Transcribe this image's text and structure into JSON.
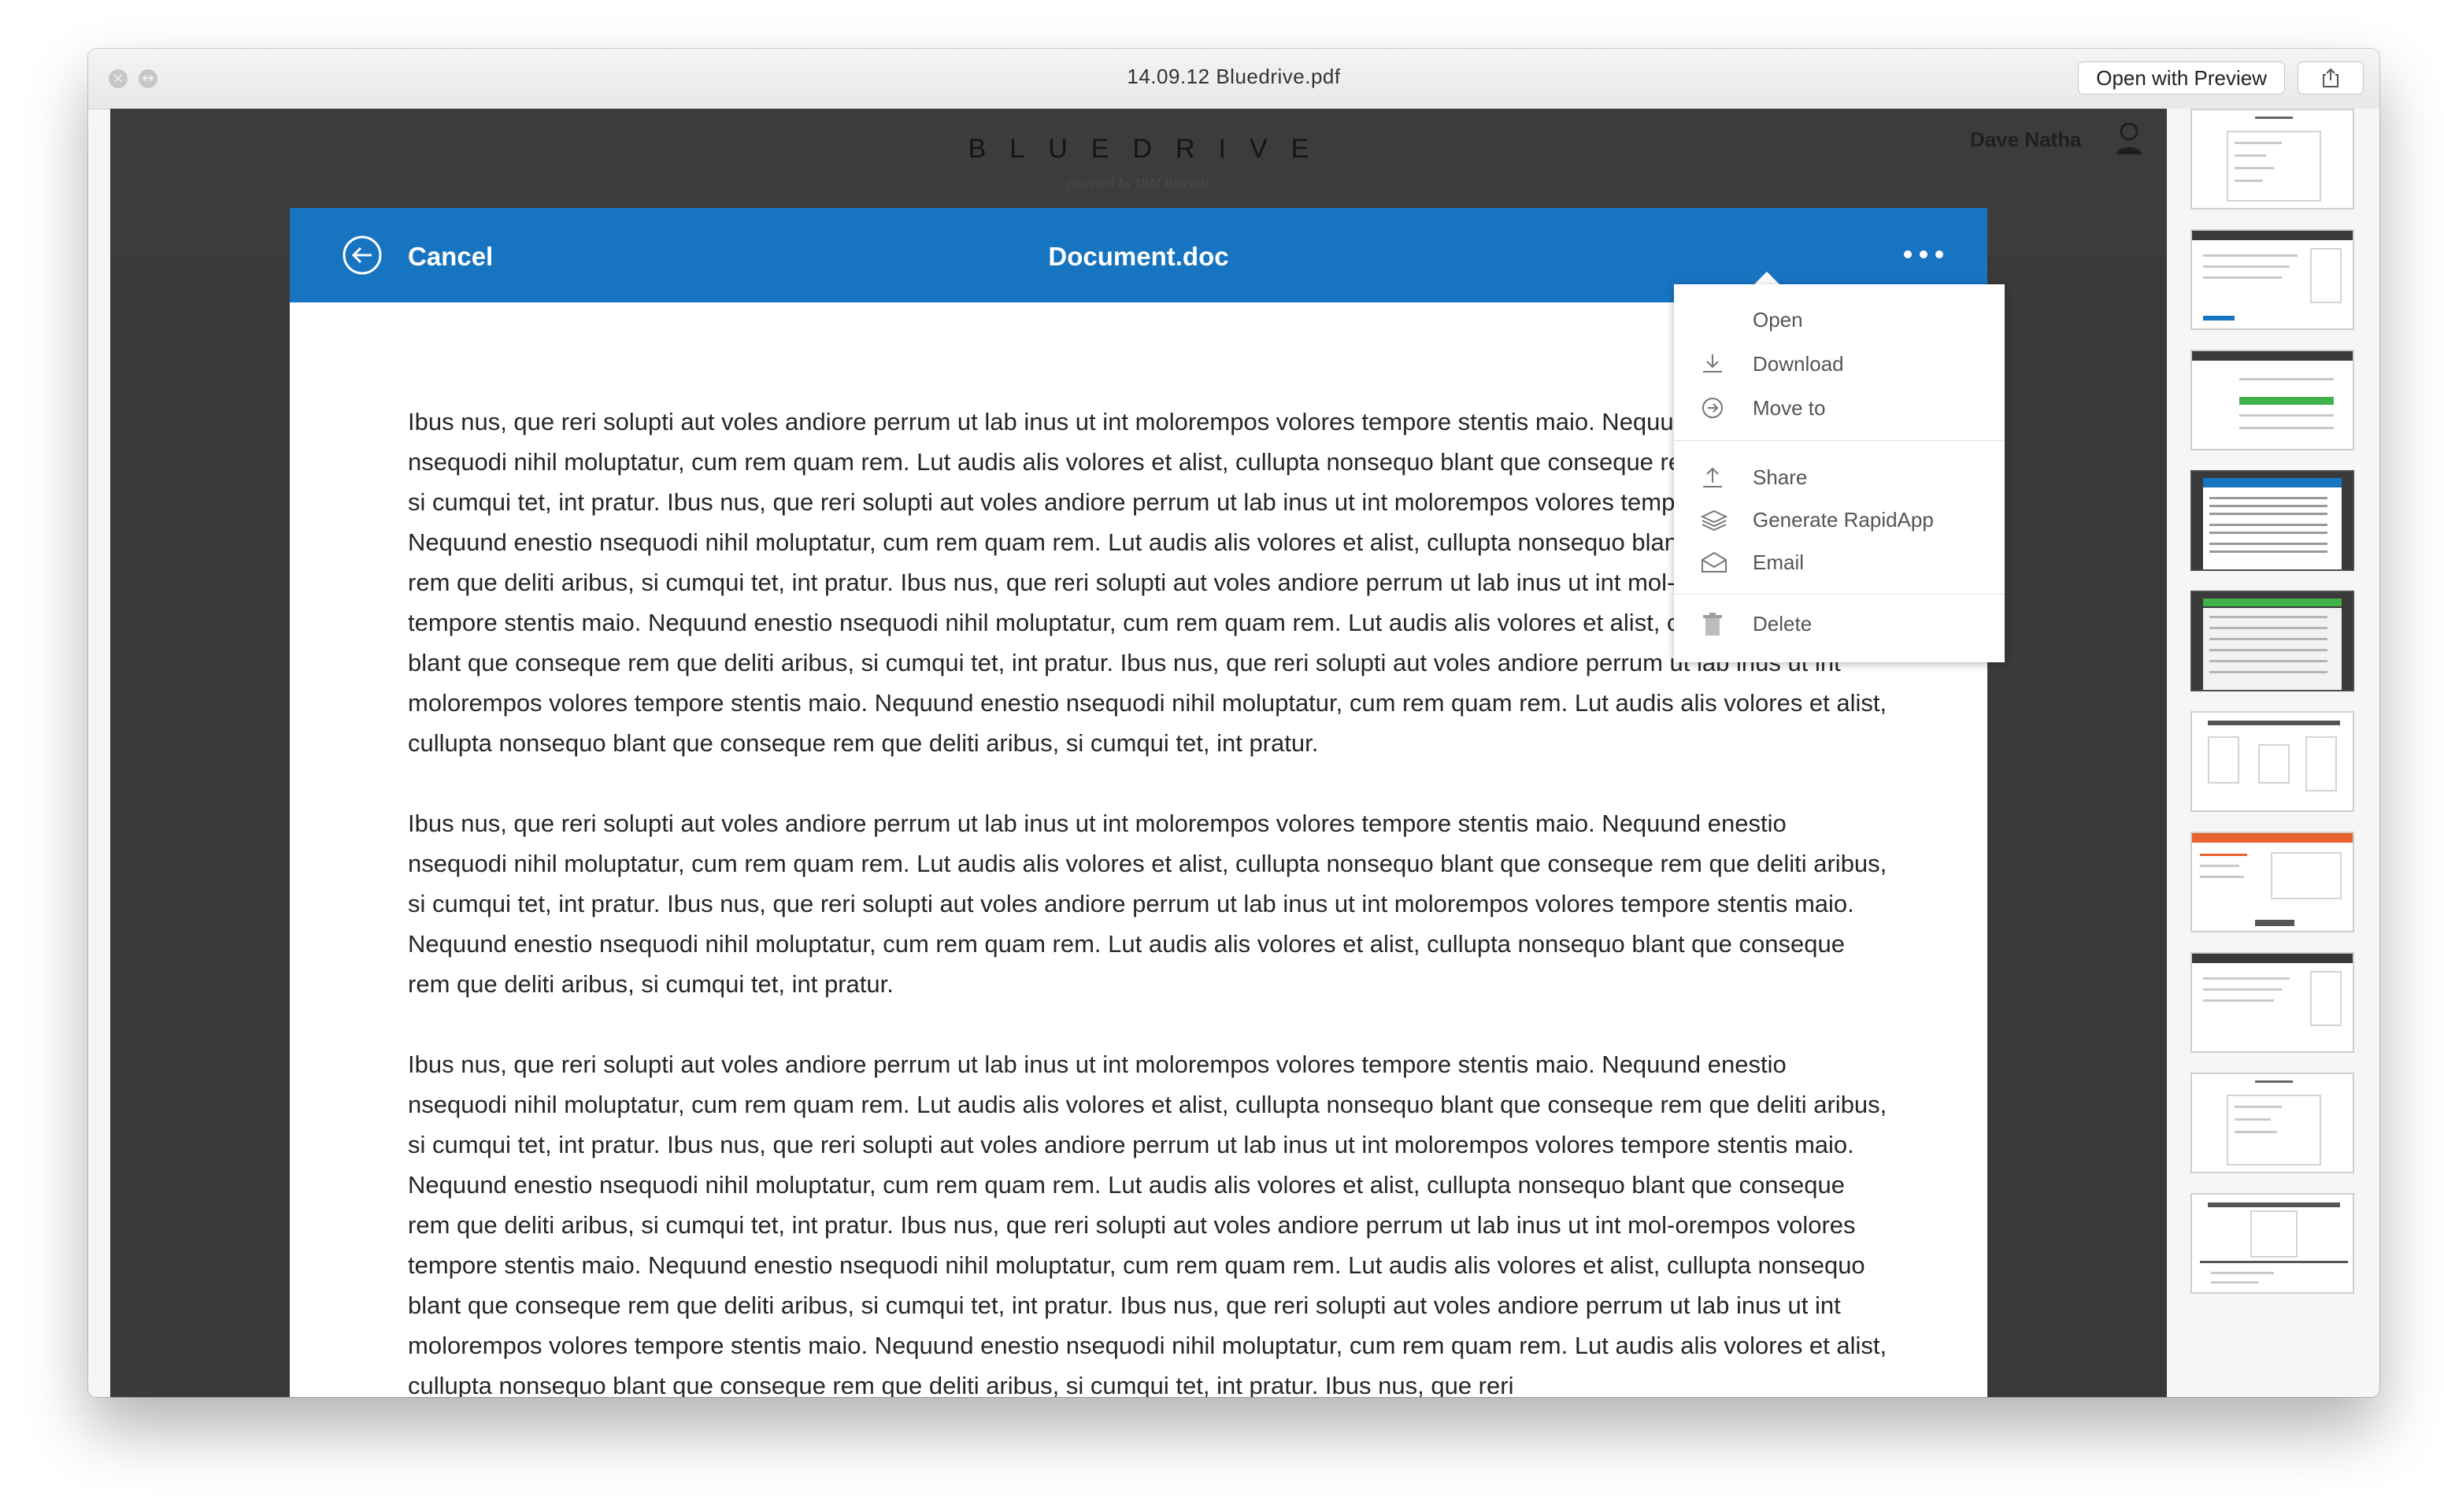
{
  "window": {
    "title": "14.09.12 Bluedrive.pdf",
    "open_with_label": "Open with Preview",
    "close_icon": "close-icon",
    "fullscreen_icon": "fullscreen-icon",
    "share_icon": "share-icon"
  },
  "app_header": {
    "logo_text": "BLUEDRIVE",
    "powered_by": "powered by IBM Bluemix",
    "user_name": "Dave Natha",
    "user_icon": "user-icon"
  },
  "modal": {
    "cancel_label": "Cancel",
    "title": "Document.doc",
    "accent_color": "#1774c1",
    "paragraphs": [
      "Ibus nus, que reri solupti aut voles andiore perrum ut lab inus ut int molorempos volores tempore stentis maio. Nequund enestio nsequodi nihil moluptatur, cum rem quam rem. Lut audis alis volores et alist, cullupta nonsequo blant que conseque rem que deliti aribus, si cumqui tet, int pratur. Ibus nus, que reri solupti aut voles andiore perrum ut lab inus ut int molorempos volores tempore stentis maio. Nequund enestio nsequodi nihil moluptatur, cum rem quam rem. Lut audis alis volores et alist, cullupta nonsequo blant que conseque rem que deliti aribus, si cumqui tet, int pratur. Ibus nus, que reri solupti aut voles andiore perrum ut lab inus ut int mol-orempos volores tempore stentis maio. Nequund enestio nsequodi nihil moluptatur, cum rem quam rem. Lut audis alis volores et alist, cullupta nonsequo blant que conseque rem que deliti aribus, si cumqui tet, int pratur. Ibus nus, que reri solupti aut voles andiore perrum ut lab inus ut int molorempos volores tempore stentis maio. Nequund enestio nsequodi nihil moluptatur, cum rem quam rem. Lut audis alis volores et alist, cullupta nonsequo blant que conseque rem que deliti aribus, si cumqui tet, int pratur.",
      "Ibus nus, que reri solupti aut voles andiore perrum ut lab inus ut int molorempos volores tempore stentis maio. Nequund enestio nsequodi nihil moluptatur, cum rem quam rem. Lut audis alis volores et alist, cullupta nonsequo blant que conseque rem que deliti aribus, si cumqui tet, int pratur. Ibus nus, que reri solupti aut voles andiore perrum ut lab inus ut int molorempos volores tempore stentis maio. Nequund enestio nsequodi nihil moluptatur, cum rem quam rem. Lut audis alis volores et alist, cullupta nonsequo blant que conseque rem que deliti aribus, si cumqui tet, int pratur.",
      "Ibus nus, que reri solupti aut voles andiore perrum ut lab inus ut int molorempos volores tempore stentis maio. Nequund enestio nsequodi nihil moluptatur, cum rem quam rem. Lut audis alis volores et alist, cullupta nonsequo blant que conseque rem que deliti aribus, si cumqui tet, int pratur. Ibus nus, que reri solupti aut voles andiore perrum ut lab inus ut int molorempos volores tempore stentis maio. Nequund enestio nsequodi nihil moluptatur, cum rem quam rem. Lut audis alis volores et alist, cullupta nonsequo blant que conseque rem que deliti aribus, si cumqui tet, int pratur. Ibus nus, que reri solupti aut voles andiore perrum ut lab inus ut int mol-orempos volores tempore stentis maio. Nequund enestio nsequodi nihil moluptatur, cum rem quam rem. Lut audis alis volores et alist, cullupta nonsequo blant que conseque rem que deliti aribus, si cumqui tet, int pratur. Ibus nus, que reri solupti aut voles andiore perrum ut lab inus ut int molorempos volores tempore stentis maio. Nequund enestio nsequodi nihil moluptatur, cum rem quam rem. Lut audis alis volores et alist, cullupta nonsequo blant que conseque rem que deliti aribus, si cumqui tet, int pratur. Ibus nus, que reri"
    ]
  },
  "menu": {
    "items": [
      {
        "label": "Open",
        "icon": "none"
      },
      {
        "label": "Download",
        "icon": "download-icon"
      },
      {
        "label": "Move to",
        "icon": "move-to-icon"
      },
      {
        "label": "Share",
        "icon": "share-icon"
      },
      {
        "label": "Generate RapidApp",
        "icon": "layers-icon"
      },
      {
        "label": "Email",
        "icon": "email-icon"
      },
      {
        "label": "Delete",
        "icon": "trash-icon"
      }
    ]
  },
  "sidebar": {
    "page_count": 10,
    "selected_page": 4
  }
}
